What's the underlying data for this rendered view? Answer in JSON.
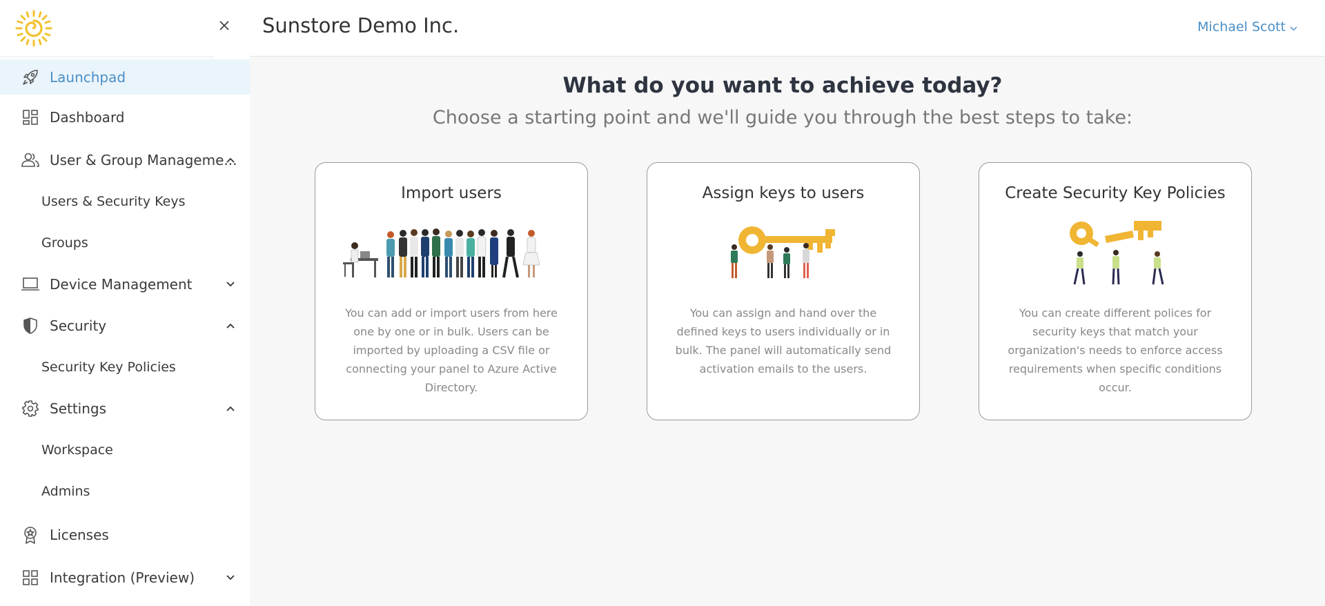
{
  "header": {
    "org_name": "Sunstore Demo Inc.",
    "user_name": "Michael Scott"
  },
  "sidebar": {
    "close_icon": "close-icon",
    "items": [
      {
        "label": "Launchpad",
        "icon": "rocket-icon",
        "active": true
      },
      {
        "label": "Dashboard",
        "icon": "dashboard-icon"
      },
      {
        "label": "User & Group Manageme...",
        "icon": "users-icon",
        "expanded": true
      },
      {
        "label": "Users & Security Keys",
        "sub": true
      },
      {
        "label": "Groups",
        "sub": true
      },
      {
        "label": "Device Management",
        "icon": "laptop-icon",
        "expanded": false
      },
      {
        "label": "Security",
        "icon": "shield-icon",
        "expanded": true
      },
      {
        "label": "Security Key Policies",
        "sub": true
      },
      {
        "label": "Settings",
        "icon": "gear-icon",
        "expanded": true
      },
      {
        "label": "Workspace",
        "sub": true
      },
      {
        "label": "Admins",
        "sub": true
      },
      {
        "label": "Licenses",
        "icon": "badge-icon"
      },
      {
        "label": "Integration (Preview)",
        "icon": "grid-icon",
        "expanded": false
      }
    ]
  },
  "main": {
    "heading": "What do you want to achieve today?",
    "subheading": "Choose a starting point and we'll guide you through the best steps to take:",
    "cards": [
      {
        "title": "Import users",
        "text": "You can add or import users from here one by one or in bulk. Users can be imported by uploading a CSV file or connecting your panel to Azure Active Directory."
      },
      {
        "title": "Assign keys to users",
        "text": "You can assign and hand over the defined keys to users individually or in bulk. The panel will automatically send activation emails to the users."
      },
      {
        "title": "Create Security Key Policies",
        "text": "You can create different polices for security keys that match your organization's needs to enforce access requirements when specific conditions occur."
      }
    ]
  },
  "colors": {
    "accent": "#4a8fc7",
    "active_bg": "#eaf4fb",
    "logo": "#f2c12e",
    "key_gold": "#f0b533"
  }
}
